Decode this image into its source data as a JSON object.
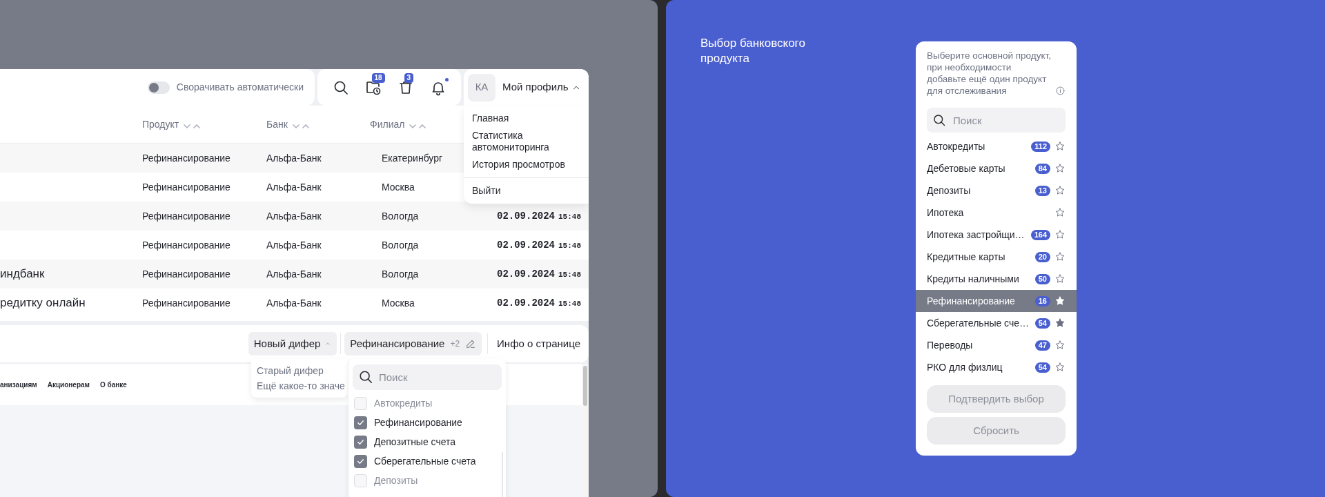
{
  "topbar": {
    "auto_collapse": {
      "label": "Сворачивать автоматически",
      "on": false
    },
    "history_badge": "18",
    "trash_badge": "3",
    "bell_unread": true
  },
  "profile": {
    "initials": "КА",
    "label": "Мой профиль",
    "expanded": true,
    "menu": [
      {
        "label": "Главная",
        "kind": "item"
      },
      {
        "label": "Статистика автомониторинга",
        "kind": "item"
      },
      {
        "label": "История просмотров",
        "kind": "item"
      },
      {
        "label": "Выйти",
        "kind": "exit"
      }
    ]
  },
  "table": {
    "columns": [
      "Продукт",
      "Банк",
      "Филиал"
    ],
    "rows": [
      {
        "product": "Рефинансирование",
        "bank": "Альфа-Банк",
        "branch": "Екатеринбург"
      },
      {
        "product": "Рефинансирование",
        "bank": "Альфа-Банк",
        "branch": "Москва"
      },
      {
        "product": "Рефинансирование",
        "bank": "Альфа-Банк",
        "branch": "Вологда",
        "date": "02.09.2024",
        "time": "15:48"
      },
      {
        "product": "Рефинансирование",
        "bank": "Альфа-Банк",
        "branch": "Вологда",
        "date": "02.09.2024",
        "time": "15:48"
      },
      {
        "column_1": "индбанк",
        "product": "Рефинансирование",
        "bank": "Альфа-Банк",
        "branch": "Вологда",
        "date": "02.09.2024",
        "time": "15:48"
      },
      {
        "column_1": "редитку онлайн",
        "product": "Рефинансирование",
        "bank": "Альфа-Банк",
        "branch": "Москва",
        "date": "02.09.2024",
        "time": "15:48"
      }
    ]
  },
  "bottom_bar": {
    "differ": {
      "label": "Новый дифер",
      "expanded": true,
      "options": [
        "Старый дифер",
        "Ещё какое-то значе"
      ]
    },
    "product_filter": {
      "label": "Рефинансирование",
      "extra": "+2",
      "expanded": true,
      "search_placeholder": "Поиск",
      "options": [
        {
          "label": "Автокредиты",
          "checked": false
        },
        {
          "label": "Рефинансирование",
          "checked": true
        },
        {
          "label": "Депозитные счета",
          "checked": true
        },
        {
          "label": "Сберегательные счета",
          "checked": true
        },
        {
          "label": "Депозиты",
          "checked": false
        }
      ]
    },
    "info_button": "Инфо о странице"
  },
  "page_nav": [
    "анизациям",
    "Акционерам",
    "О банке"
  ],
  "product_picker": {
    "title": "Выбор банковского продукта",
    "hint": "Выберите основной продукт, при необходимости добавьте ещё один продукт для отслеживания",
    "search_placeholder": "Поиск",
    "products": [
      {
        "label": "Автокредиты",
        "count": "112",
        "starred": false,
        "selected": false
      },
      {
        "label": "Дебетовые карты",
        "count": "84",
        "starred": false,
        "selected": false
      },
      {
        "label": "Депозиты",
        "count": "13",
        "starred": false,
        "selected": false
      },
      {
        "label": "Ипотека",
        "starred": false,
        "selected": false
      },
      {
        "label": "Ипотека застройщи…",
        "count": "164",
        "starred": false,
        "selected": false
      },
      {
        "label": "Кредитные карты",
        "count": "20",
        "starred": false,
        "selected": false
      },
      {
        "label": "Кредиты наличными",
        "count": "50",
        "starred": false,
        "selected": false
      },
      {
        "label": "Рефинансирование",
        "count": "16",
        "starred": true,
        "selected": true
      },
      {
        "label": "Сберегательные сче…",
        "count": "54",
        "starred": true,
        "selected": false
      },
      {
        "label": "Переводы",
        "count": "47",
        "starred": false,
        "selected": false
      },
      {
        "label": "РКО для физлиц",
        "count": "54",
        "starred": false,
        "selected": false
      }
    ],
    "buttons": [
      "Подтвердить выбор",
      "Сбросить"
    ]
  }
}
